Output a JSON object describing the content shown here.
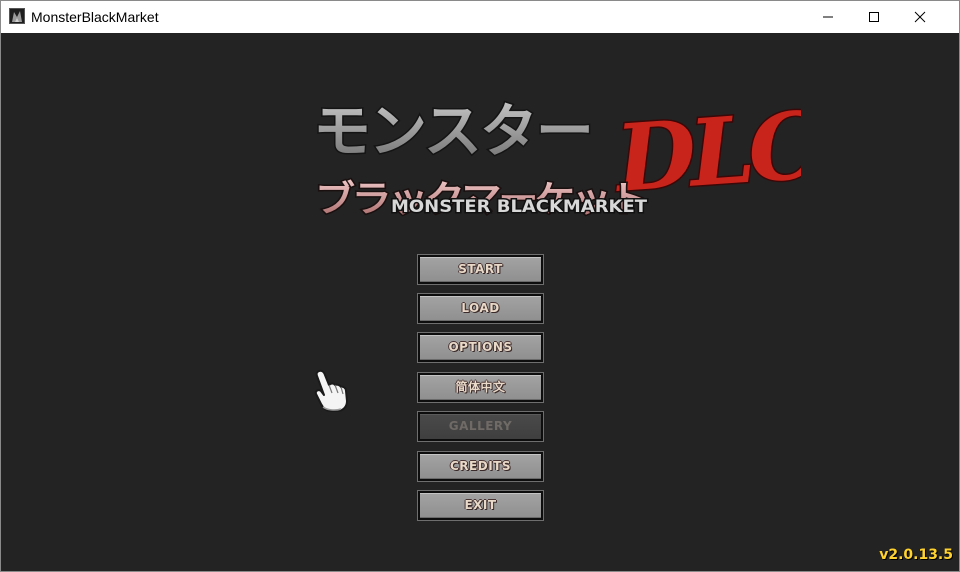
{
  "window": {
    "title": "MonsterBlackMarket",
    "icon": "app-icon",
    "controls": [
      "minimize-icon",
      "maximize-icon",
      "close-icon"
    ]
  },
  "logo": {
    "line1": "モンスター",
    "line2": "ブラックマーケット",
    "dlc": "DLC",
    "subtitle": "MONSTER BLACKMARKET"
  },
  "menu": {
    "start": "START",
    "load": "LOAD",
    "options": "OPTIONS",
    "language": "简体中文",
    "gallery": "GALLERY",
    "credits": "CREDITS",
    "exit": "EXIT"
  },
  "version": "v2.0.13.5",
  "colors": {
    "background": "#232323",
    "button": "#999999",
    "button_text": "#e8d9c8",
    "version_text": "#ffd22e",
    "dlc_red": "#c8241c"
  }
}
